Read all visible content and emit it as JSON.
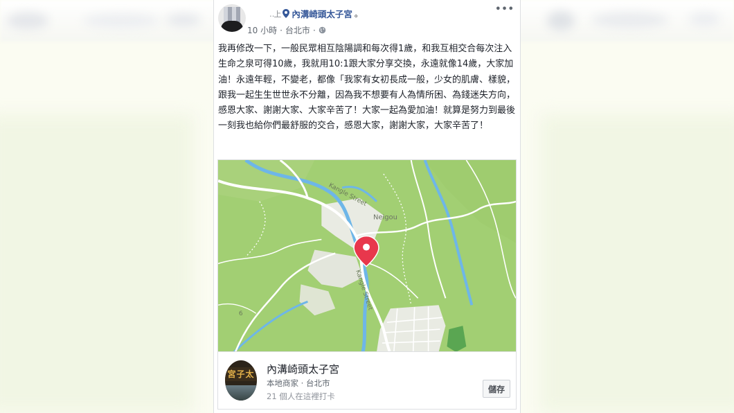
{
  "post": {
    "author_redacted": "‥上",
    "tagged_place": "內溝崎頭太子宮",
    "tagged_suffix": "。",
    "time": "10 小時",
    "separator": "·",
    "location": "台北市",
    "menu_icon": "more-options-icon",
    "body": "我再修改一下，一般民眾相互陰陽調和每次得1歲，和我互相交合每次注入生命之泉可得10歲，我就用10:1跟大家分享交換，永遠就像14歲，大家加油！永遠年輕，不變老，都像「我家有女初長成一般，少女的肌膚、樣貌，跟我一起生生世世永不分離，因為我不想要有人為情所困、為錢迷失方向，感恩大家、謝謝大家、大家辛苦了！大家一起為愛加油！就算是努力到最後一刻我也給你們最舒服的交合，感恩大家，謝謝大家，大家辛苦了！"
  },
  "map": {
    "labels": {
      "street_top": "Kangle Street",
      "town": "Neigou",
      "street_mid": "Kangle Street",
      "number": "6"
    },
    "colors": {
      "land": "#a2cf73",
      "water": "#6eb6e8",
      "road": "#ffffff",
      "urban": "#e9ebe3",
      "pin": "#e8374c"
    }
  },
  "place": {
    "name": "內溝崎頭太子宮",
    "category": "本地商家 · 台北市",
    "checkins": "21 個人在這裡打卡",
    "save_label": "儲存",
    "logo_text": "宮子太"
  }
}
